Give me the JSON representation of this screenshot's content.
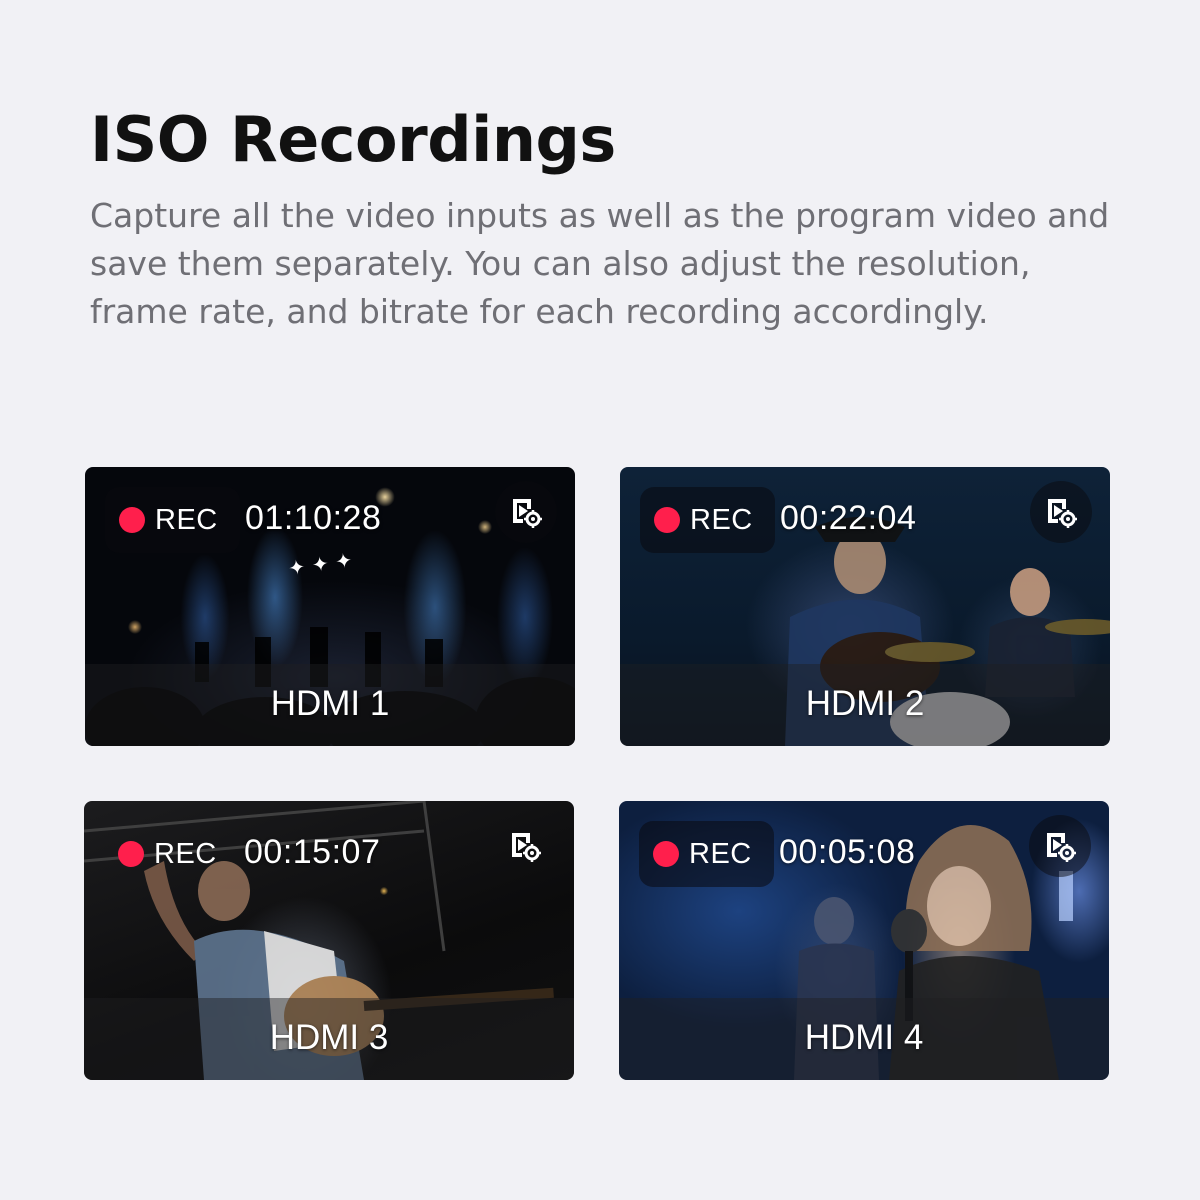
{
  "header": {
    "title": "ISO Recordings",
    "description": "Capture all the video inputs as well as the program video and save them separately.  You can also adjust the resolution, frame rate, and bitrate for each recording accordingly."
  },
  "rec_color": "#ff1f4c",
  "recordings": [
    {
      "status": "REC",
      "timecode": "01:10:28",
      "input": "HDMI 1"
    },
    {
      "status": "REC",
      "timecode": "00:22:04",
      "input": "HDMI 2"
    },
    {
      "status": "REC",
      "timecode": "00:15:07",
      "input": "HDMI 3"
    },
    {
      "status": "REC",
      "timecode": "00:05:08",
      "input": "HDMI 4"
    }
  ],
  "icons": {
    "settings": "video-settings-icon",
    "status": "record-dot-icon"
  }
}
